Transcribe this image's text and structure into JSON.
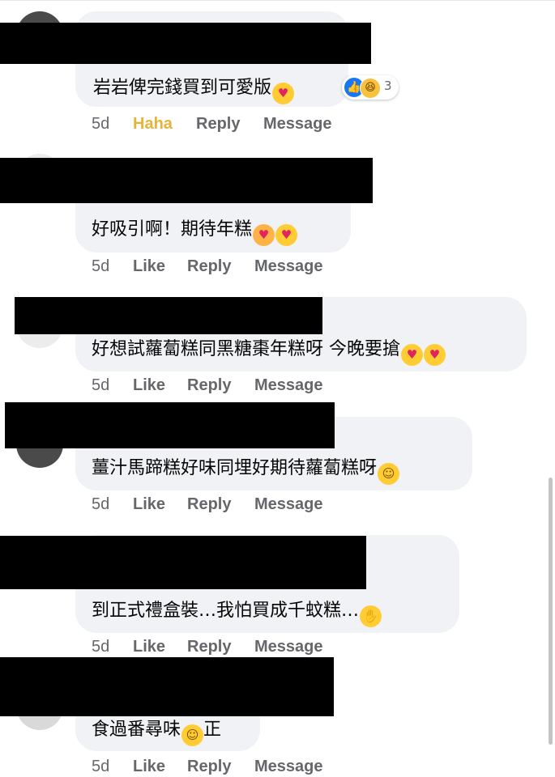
{
  "comments": [
    {
      "text": "岩岩俾完錢買到可愛版",
      "emojis": [
        "heart-eyes"
      ],
      "time": "5d",
      "reaction_label": "Haha",
      "reply_label": "Reply",
      "message_label": "Message",
      "reaction_count": "3",
      "reaction_icons": [
        "like",
        "haha"
      ]
    },
    {
      "text": "好吸引啊！期待年糕",
      "emojis": [
        "smiling-face-with-hearts",
        "heart-eyes"
      ],
      "time": "5d",
      "reaction_label": "Like",
      "reply_label": "Reply",
      "message_label": "Message"
    },
    {
      "text": "好想試蘿蔔糕同黑糖棗年糕呀 今晚要搶",
      "emojis": [
        "heart-eyes",
        "heart-eyes"
      ],
      "time": "5d",
      "reaction_label": "Like",
      "reply_label": "Reply",
      "message_label": "Message"
    },
    {
      "text": "薑汁馬蹄糕好味同埋好期待蘿蔔糕呀",
      "emojis": [
        "yum-face"
      ],
      "time": "5d",
      "reaction_label": "Like",
      "reply_label": "Reply",
      "message_label": "Message"
    },
    {
      "text": "到正式禮盒裝…我怕買成千蚊糕…",
      "emojis": [
        "facepalm"
      ],
      "time": "5d",
      "reaction_label": "Like",
      "reply_label": "Reply",
      "message_label": "Message"
    },
    {
      "text_before": "食過番尋味",
      "text_after": "正",
      "emojis": [
        "yum-face"
      ],
      "time": "5d",
      "reaction_label": "Like",
      "reply_label": "Reply",
      "message_label": "Message"
    }
  ]
}
